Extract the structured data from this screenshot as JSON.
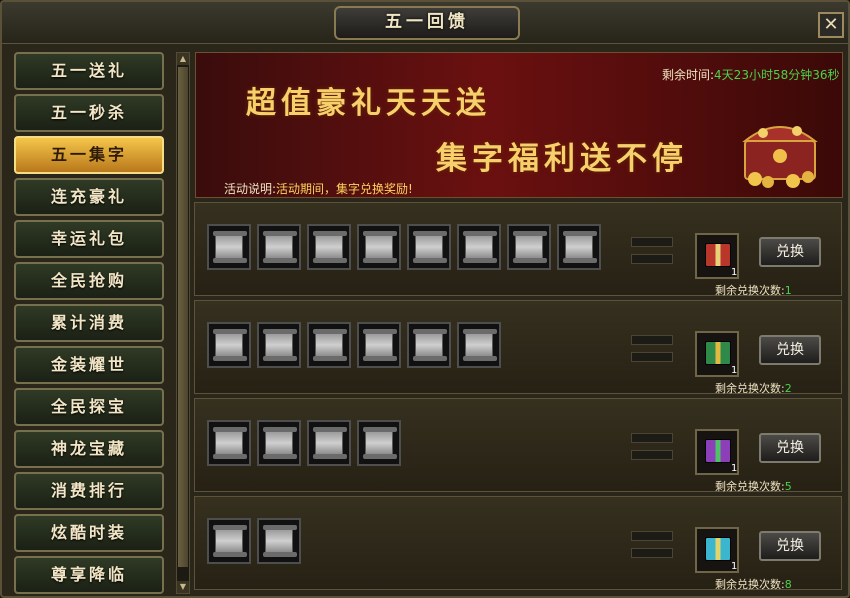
{
  "title": "五一回馈",
  "close": "✕",
  "sidebar": {
    "items": [
      {
        "label": "五一送礼"
      },
      {
        "label": "五一秒杀"
      },
      {
        "label": "五一集字",
        "active": true
      },
      {
        "label": "连充豪礼"
      },
      {
        "label": "幸运礼包"
      },
      {
        "label": "全民抢购"
      },
      {
        "label": "累计消费"
      },
      {
        "label": "金装耀世"
      },
      {
        "label": "全民探宝"
      },
      {
        "label": "神龙宝藏"
      },
      {
        "label": "消费排行"
      },
      {
        "label": "炫酷时装"
      },
      {
        "label": "尊享降临"
      }
    ]
  },
  "scroll": {
    "up": "▲",
    "down": "▼"
  },
  "banner": {
    "line1": "超值豪礼天天送",
    "line2": "集字福利送不停",
    "timer_label": "剩余时间:",
    "timer_value": "4天23小时58分钟36秒",
    "desc_label": "活动说明:",
    "desc_value": "活动期间，集字兑换奖励!"
  },
  "rows": [
    {
      "slots": 8,
      "gift_color": "#b8362a",
      "gift_count": "1",
      "btn": "兑换",
      "remain_label": "剩余兑换次数:",
      "remain": "1"
    },
    {
      "slots": 6,
      "gift_color": "#cc9b2a",
      "gift_count": "1",
      "btn": "兑换",
      "remain_label": "剩余兑换次数:",
      "remain": "2"
    },
    {
      "slots": 4,
      "gift_color": "#8d3fba",
      "gift_count": "1",
      "btn": "兑换",
      "remain_label": "剩余兑换次数:",
      "remain": "5"
    },
    {
      "slots": 2,
      "gift_color": "#3bb6cf",
      "gift_count": "1",
      "btn": "兑换",
      "remain_label": "剩余兑换次数:",
      "remain": "8"
    }
  ],
  "colors": {
    "accent": "#f4c64a",
    "remain": "#4bd34a",
    "timer": "#4bd34a"
  },
  "icons": {
    "slot": "scroll-icon",
    "gift": "gift-box-icon",
    "chest": "treasure-chest-icon",
    "close": "close-icon"
  }
}
